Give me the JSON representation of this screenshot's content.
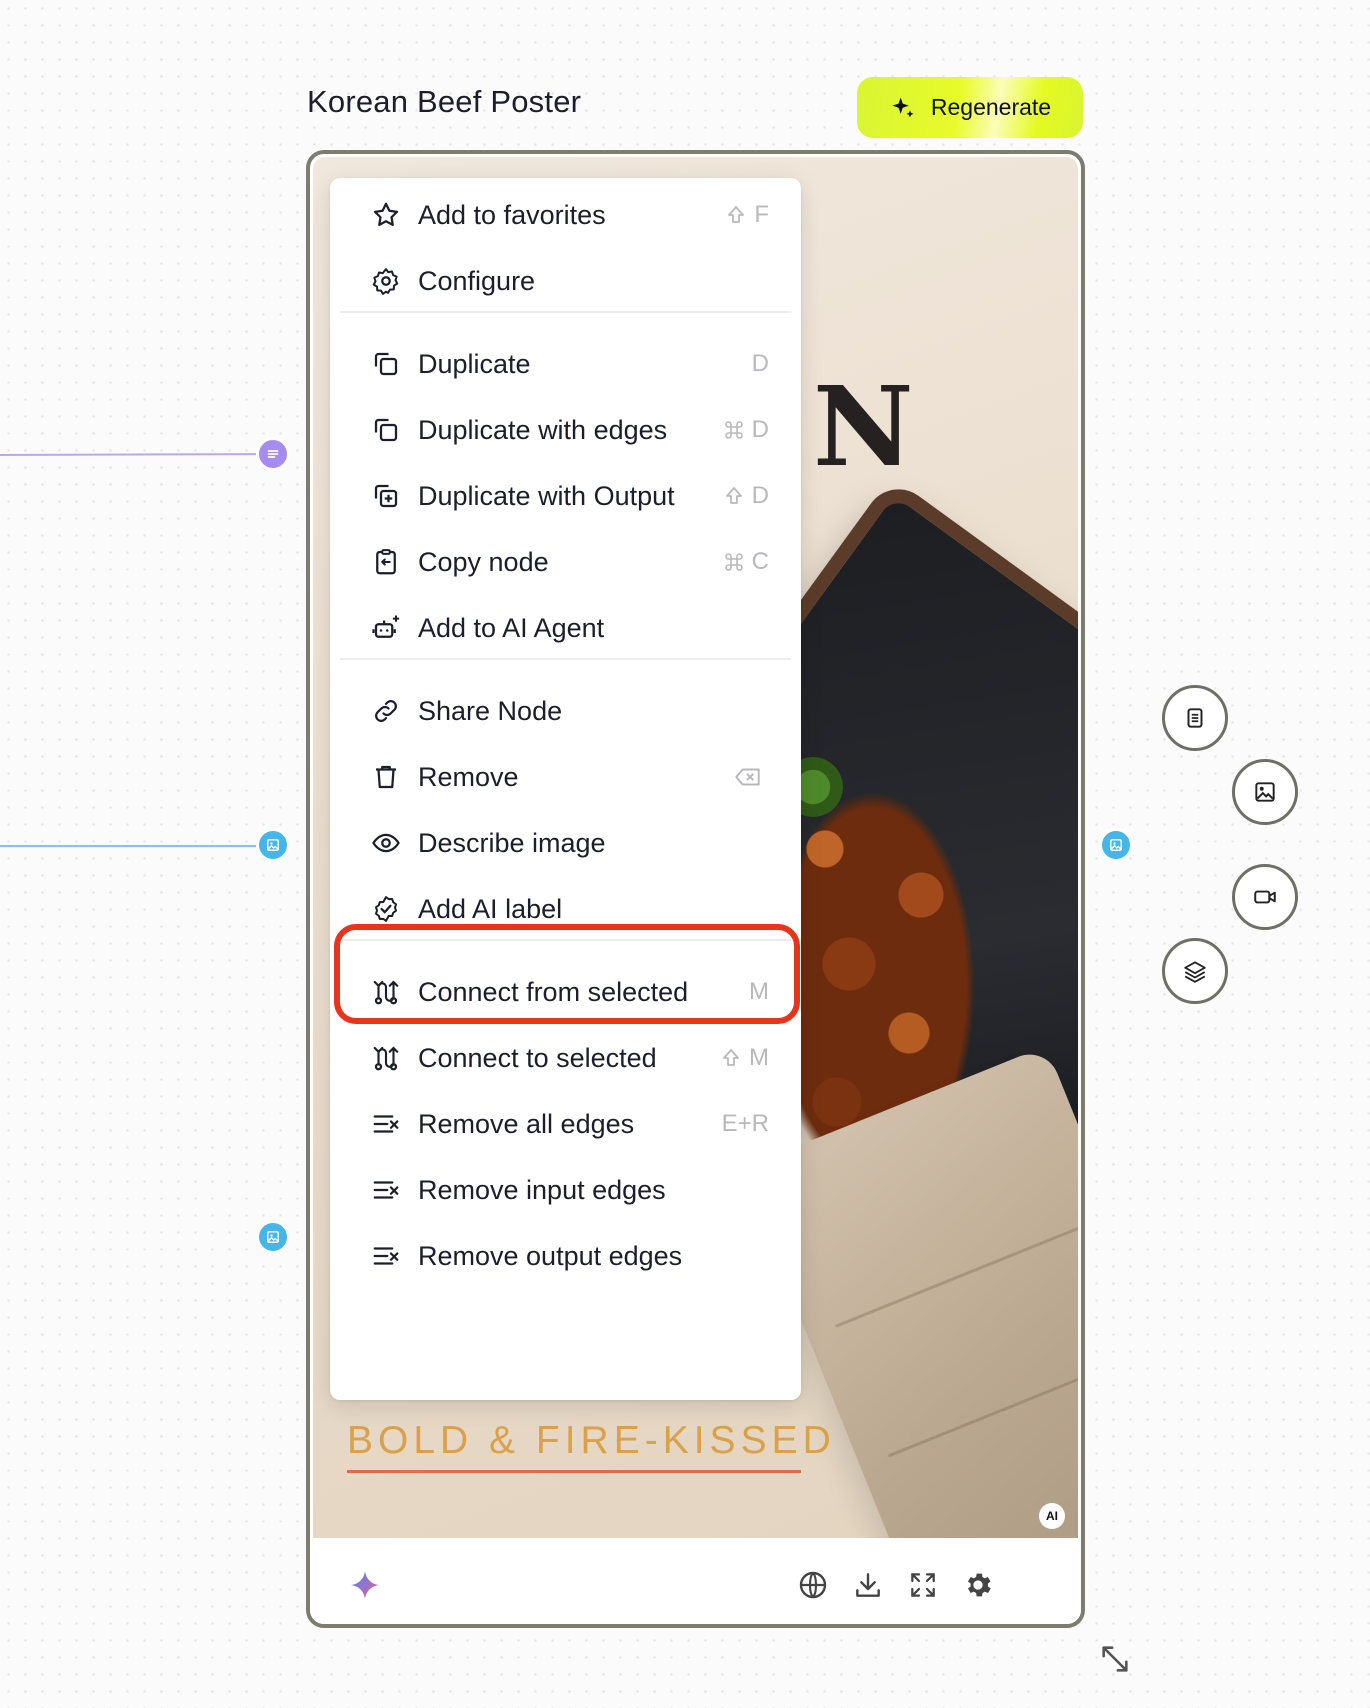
{
  "node": {
    "title": "Korean Beef Poster",
    "regenerate_label": "Regenerate",
    "poster": {
      "headline_fragment": "N",
      "tagline": "BOLD & FIRE-KISSED",
      "ai_badge": "AI"
    }
  },
  "context_menu": {
    "items": [
      {
        "label": "Add to favorites",
        "icon": "star-icon",
        "shortcut_key": "F",
        "shortcut_modifier": "shift"
      },
      {
        "label": "Configure",
        "icon": "gear-icon",
        "shortcut_key": "",
        "shortcut_modifier": ""
      },
      {
        "label": "Duplicate",
        "icon": "duplicate-icon",
        "shortcut_key": "D",
        "shortcut_modifier": ""
      },
      {
        "label": "Duplicate with edges",
        "icon": "duplicate-icon",
        "shortcut_key": "D",
        "shortcut_modifier": "cmd"
      },
      {
        "label": "Duplicate with Output",
        "icon": "duplicate-plus-icon",
        "shortcut_key": "D",
        "shortcut_modifier": "shift"
      },
      {
        "label": "Copy node",
        "icon": "clipboard-icon",
        "shortcut_key": "C",
        "shortcut_modifier": "cmd"
      },
      {
        "label": "Add to AI Agent",
        "icon": "robot-plus-icon",
        "shortcut_key": "",
        "shortcut_modifier": ""
      },
      {
        "label": "Share Node",
        "icon": "link-icon",
        "shortcut_key": "",
        "shortcut_modifier": ""
      },
      {
        "label": "Remove",
        "icon": "trash-icon",
        "shortcut_key": "",
        "shortcut_modifier": "backspace"
      },
      {
        "label": "Describe image",
        "icon": "eye-icon",
        "shortcut_key": "",
        "shortcut_modifier": ""
      },
      {
        "label": "Add AI label",
        "icon": "check-badge-icon",
        "shortcut_key": "",
        "shortcut_modifier": ""
      },
      {
        "label": "Connect from selected",
        "icon": "route-icon",
        "shortcut_key": "M",
        "shortcut_modifier": ""
      },
      {
        "label": "Connect to selected",
        "icon": "route-icon",
        "shortcut_key": "M",
        "shortcut_modifier": "shift"
      },
      {
        "label": "Remove all edges",
        "icon": "list-x-icon",
        "shortcut_key": "E+R",
        "shortcut_modifier": ""
      },
      {
        "label": "Remove input edges",
        "icon": "list-x-icon",
        "shortcut_key": "",
        "shortcut_modifier": ""
      },
      {
        "label": "Remove output edges",
        "icon": "list-x-icon",
        "shortcut_key": "",
        "shortcut_modifier": ""
      }
    ],
    "highlighted": "Add AI label"
  },
  "side_tools": [
    "text-node-icon",
    "image-node-icon",
    "video-node-icon",
    "layers-icon"
  ],
  "footer_icons": [
    "globe-icon",
    "download-icon",
    "fullscreen-icon",
    "settings-icon"
  ],
  "colors": {
    "regenerate_bg": "#e4fa20",
    "highlight": "#e8341c",
    "handle_purple": "#a68cf0",
    "handle_blue": "#45b6ea",
    "node_border": "#7c7c70"
  }
}
